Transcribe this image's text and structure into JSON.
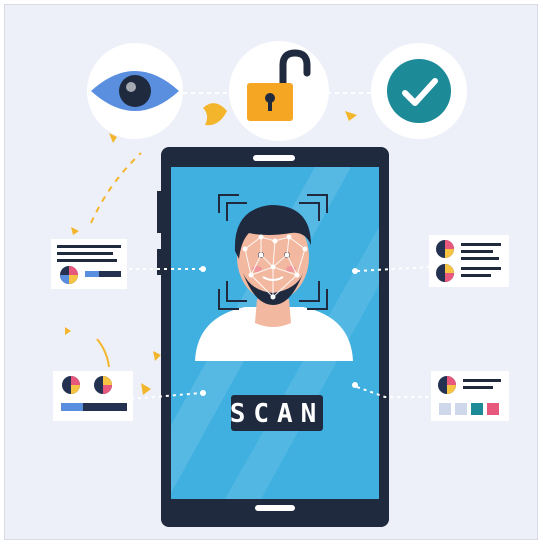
{
  "scan_button": {
    "label": "SCAN"
  },
  "colors": {
    "background": "#eef0f9",
    "phone_body": "#1f2a3f",
    "screen": "#3fb0e0",
    "scan_button_bg": "#1f2a3f",
    "lock_orange": "#f5a623",
    "check_teal": "#1d8a98",
    "eye_blue": "#5a8fe0",
    "accent_yellow": "#f3b52b",
    "chart_pink": "#e8577c",
    "chart_yellow": "#f6c342",
    "chart_navy": "#243151"
  },
  "icons": {
    "eye": "eye-icon",
    "lock": "unlocked-padlock-icon",
    "check": "checkmark-icon"
  }
}
